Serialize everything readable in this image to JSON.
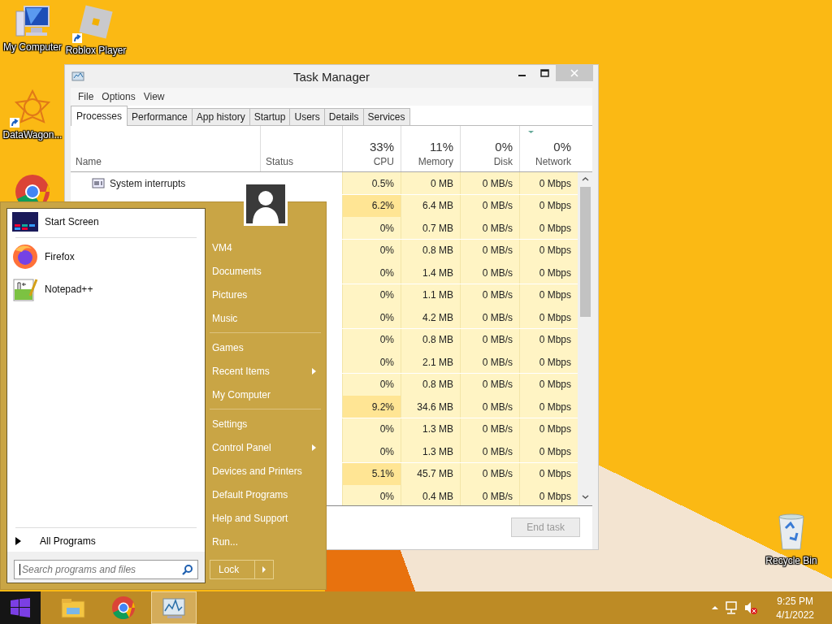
{
  "desktop_icons": [
    {
      "kind": "computer",
      "label": "My Computer",
      "shortcut": false
    },
    {
      "kind": "roblox",
      "label": "Roblox Player",
      "shortcut": true
    },
    {
      "kind": "datawagon",
      "label": "DataWagon...",
      "shortcut": true
    },
    {
      "kind": "chrome"
    },
    {
      "kind": "recycle",
      "label": "Recycle Bin",
      "shortcut": false
    }
  ],
  "task_manager": {
    "title": "Task Manager",
    "menu": [
      "File",
      "Options",
      "View"
    ],
    "tabs": [
      {
        "label": "Processes",
        "selected": true
      },
      {
        "label": "Performance",
        "selected": false
      },
      {
        "label": "App history",
        "selected": false
      },
      {
        "label": "Startup",
        "selected": false
      },
      {
        "label": "Users",
        "selected": false
      },
      {
        "label": "Details",
        "selected": false
      },
      {
        "label": "Services",
        "selected": false
      }
    ],
    "columns": [
      {
        "label": "Name",
        "sorted": false
      },
      {
        "label": "Status",
        "sorted": false
      },
      {
        "label": "CPU",
        "total": "33%",
        "sorted": false
      },
      {
        "label": "Memory",
        "total": "11%",
        "sorted": false
      },
      {
        "label": "Disk",
        "total": "0%",
        "sorted": false
      },
      {
        "label": "Network",
        "total": "0%",
        "sorted": true
      }
    ],
    "rows": [
      {
        "name": "System interrupts",
        "cpu": "0.5%",
        "memory": "0 MB",
        "disk": "0 MB/s",
        "network": "0 Mbps",
        "cpu_hot": false
      },
      {
        "cpu": "6.2%",
        "memory": "6.4 MB",
        "disk": "0 MB/s",
        "network": "0 Mbps",
        "cpu_hot": true
      },
      {
        "cpu": "0%",
        "memory": "0.7 MB",
        "disk": "0 MB/s",
        "network": "0 Mbps",
        "cpu_hot": false
      },
      {
        "cpu": "0%",
        "memory": "0.8 MB",
        "disk": "0 MB/s",
        "network": "0 Mbps",
        "cpu_hot": false
      },
      {
        "cpu": "0%",
        "memory": "1.4 MB",
        "disk": "0 MB/s",
        "network": "0 Mbps",
        "cpu_hot": false
      },
      {
        "cpu": "0%",
        "memory": "1.1 MB",
        "disk": "0 MB/s",
        "network": "0 Mbps",
        "cpu_hot": false
      },
      {
        "cpu": "0%",
        "memory": "4.2 MB",
        "disk": "0 MB/s",
        "network": "0 Mbps",
        "cpu_hot": false
      },
      {
        "cpu": "0%",
        "memory": "0.8 MB",
        "disk": "0 MB/s",
        "network": "0 Mbps",
        "cpu_hot": false
      },
      {
        "cpu": "0%",
        "memory": "2.1 MB",
        "disk": "0 MB/s",
        "network": "0 Mbps",
        "cpu_hot": false
      },
      {
        "cpu": "0%",
        "memory": "0.8 MB",
        "disk": "0 MB/s",
        "network": "0 Mbps",
        "cpu_hot": false
      },
      {
        "cpu": "9.2%",
        "memory": "34.6 MB",
        "disk": "0 MB/s",
        "network": "0 Mbps",
        "cpu_hot": true
      },
      {
        "cpu": "0%",
        "memory": "1.3 MB",
        "disk": "0 MB/s",
        "network": "0 Mbps",
        "cpu_hot": false
      },
      {
        "cpu": "0%",
        "memory": "1.3 MB",
        "disk": "0 MB/s",
        "network": "0 Mbps",
        "cpu_hot": false
      },
      {
        "cpu": "5.1%",
        "memory": "45.7 MB",
        "disk": "0 MB/s",
        "network": "0 Mbps",
        "cpu_hot": true
      },
      {
        "cpu": "0%",
        "memory": "0.4 MB",
        "disk": "0 MB/s",
        "network": "0 Mbps",
        "cpu_hot": false
      }
    ],
    "end_task": {
      "label": "End task",
      "disabled": true
    }
  },
  "start_menu": {
    "pinned": [
      {
        "kind": "start_screen",
        "label": "Start Screen"
      }
    ],
    "recent": [
      {
        "kind": "firefox",
        "label": "Firefox"
      },
      {
        "kind": "notepadpp",
        "label": "Notepad++"
      }
    ],
    "all_programs": "All Programs",
    "search": {
      "placeholder": "Search programs and files"
    },
    "places": [
      [
        {
          "label": "VM4",
          "submenu": false
        },
        {
          "label": "Documents",
          "submenu": false
        },
        {
          "label": "Pictures",
          "submenu": false
        },
        {
          "label": "Music",
          "submenu": false
        }
      ],
      [
        {
          "label": "Games",
          "submenu": false
        },
        {
          "label": "Recent Items",
          "submenu": true
        },
        {
          "label": "My Computer",
          "submenu": false
        }
      ],
      [
        {
          "label": "Settings",
          "submenu": false
        },
        {
          "label": "Control Panel",
          "submenu": true
        },
        {
          "label": "Devices and Printers",
          "submenu": false
        },
        {
          "label": "Default Programs",
          "submenu": false
        },
        {
          "label": "Help and Support",
          "submenu": false
        },
        {
          "label": "Run...",
          "submenu": false
        }
      ]
    ],
    "lock": "Lock"
  },
  "taskbar": {
    "apps": [
      {
        "kind": "explorer",
        "selected": false
      },
      {
        "kind": "chrome",
        "selected": false
      },
      {
        "kind": "taskmgr",
        "selected": true
      }
    ],
    "volume_muted": true,
    "time": "9:25 PM",
    "date": "4/1/2022"
  }
}
